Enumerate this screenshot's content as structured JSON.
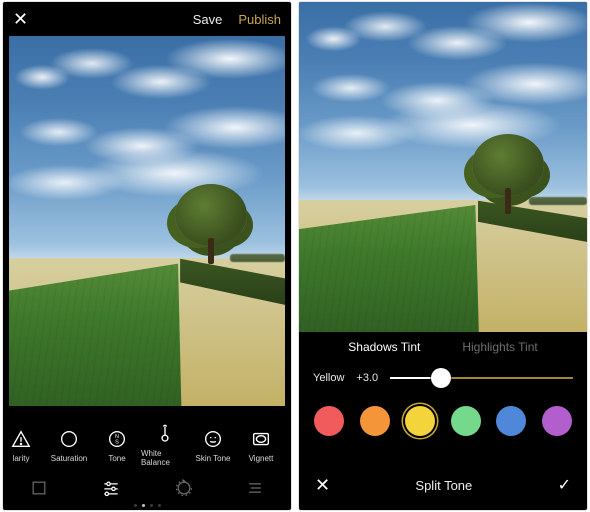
{
  "left": {
    "top": {
      "save": "Save",
      "publish": "Publish"
    },
    "tools": [
      {
        "key": "clarity",
        "label": "larity",
        "icon": "triangle-warn"
      },
      {
        "key": "saturation",
        "label": "Saturation",
        "icon": "circle"
      },
      {
        "key": "tone",
        "label": "Tone",
        "icon": "ns-circle"
      },
      {
        "key": "wbalance",
        "label": "White Balance",
        "icon": "thermometer"
      },
      {
        "key": "skintone",
        "label": "Skin Tone",
        "icon": "face"
      },
      {
        "key": "vignette",
        "label": "Vignett",
        "icon": "vignette"
      }
    ],
    "tabs": {
      "active_index": 1
    }
  },
  "right": {
    "tint_tabs": {
      "shadows": "Shadows Tint",
      "highlights": "Highlights Tint",
      "active": "shadows"
    },
    "slider": {
      "color_label": "Yellow",
      "value": "+3.0",
      "percent": 28
    },
    "swatches": [
      {
        "key": "red",
        "hex": "#f25b5b",
        "selected": false
      },
      {
        "key": "orange",
        "hex": "#f4953a",
        "selected": false
      },
      {
        "key": "yellow",
        "hex": "#f3d43b",
        "selected": true
      },
      {
        "key": "green",
        "hex": "#74d98a",
        "selected": false
      },
      {
        "key": "blue",
        "hex": "#4f88d9",
        "selected": false
      },
      {
        "key": "purple",
        "hex": "#b25fcd",
        "selected": false
      }
    ],
    "bottom": {
      "title": "Split Tone"
    }
  }
}
